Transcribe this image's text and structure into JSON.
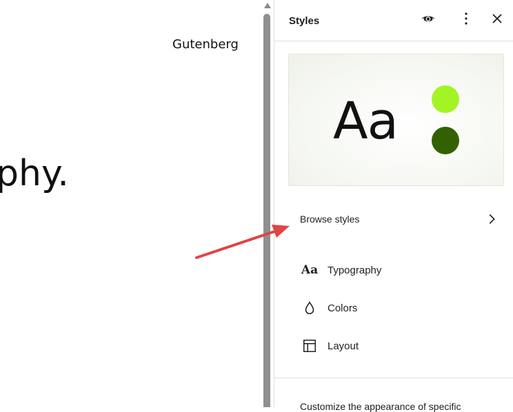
{
  "canvas": {
    "site_title": "Gutenberg",
    "big_text": "phy."
  },
  "sidebar": {
    "title": "Styles",
    "header_icons": [
      "eye-icon",
      "more-vertical-icon",
      "close-icon"
    ],
    "preview": {
      "sample_text": "Aa",
      "colors": [
        "#a3f425",
        "#346100"
      ]
    },
    "browse_styles": "Browse styles",
    "nav": [
      {
        "label": "Typography",
        "icon": "typography-icon",
        "glyph": "Aa"
      },
      {
        "label": "Colors",
        "icon": "droplet-icon"
      },
      {
        "label": "Layout",
        "icon": "layout-icon"
      }
    ],
    "footer_text": "Customize the appearance of specific"
  },
  "annotation": {
    "arrow_color": "#e04545"
  }
}
